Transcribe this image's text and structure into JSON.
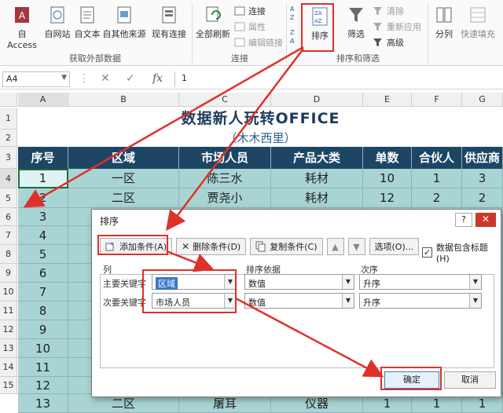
{
  "ribbon": {
    "access": "自 Access",
    "web": "自网站",
    "text": "自文本",
    "other": "自其他来源",
    "existing": "现有连接",
    "refresh_all": "全部刷新",
    "connections": "连接",
    "properties": "属性",
    "edit_links": "编辑链接",
    "sort": "排序",
    "filter": "筛选",
    "clear": "清除",
    "reapply": "重新应用",
    "advanced": "高级",
    "split": "分列",
    "flash_fill": "快速填充",
    "group_external": "获取外部数据",
    "group_connections": "连接",
    "group_sort_filter": "排序和筛选"
  },
  "formula_bar": {
    "name_box": "A4",
    "value": "1"
  },
  "columns": [
    "A",
    "B",
    "C",
    "D",
    "E",
    "F",
    "G"
  ],
  "row_numbers": [
    "1",
    "2",
    "3",
    "4",
    "5",
    "6",
    "7",
    "8",
    "9",
    "10",
    "11",
    "12",
    "13",
    "14",
    "15"
  ],
  "sheet": {
    "title": "数据新人玩转OFFICE",
    "subtitle": "（木木西里）",
    "headers": [
      "序号",
      "区域",
      "市场人员",
      "产品大类",
      "单数",
      "合伙人",
      "供应商"
    ],
    "rows": [
      [
        "1",
        "一区",
        "陈三水",
        "耗材",
        "10",
        "1",
        "3"
      ],
      [
        "2",
        "二区",
        "贾尧小",
        "耗材",
        "12",
        "2",
        "2"
      ]
    ],
    "seq_numbers": [
      "3",
      "4",
      "5",
      "6",
      "7",
      "8",
      "9",
      "10",
      "11",
      "12",
      "13"
    ],
    "last_row": [
      "",
      "二区",
      "屠耳",
      "仪器",
      "1",
      "1",
      "1"
    ]
  },
  "dialog": {
    "title": "排序",
    "help": "?",
    "close": "✕",
    "add": "添加条件(A)",
    "delete": "删除条件(D)",
    "copy": "复制条件(C)",
    "options": "选项(O)...",
    "has_header": "数据包含标题(H)",
    "col_header": "列",
    "basis_header": "排序依据",
    "order_header": "次序",
    "primary_label": "主要关键字",
    "secondary_label": "次要关键字",
    "primary_key": "区域",
    "secondary_key": "市场人员",
    "basis1": "数值",
    "basis2": "数值",
    "order1": "升序",
    "order2": "升序",
    "ok": "确定",
    "cancel": "取消"
  },
  "colors": {
    "header_bg": "#1d4664",
    "teal_fill": "#a9d4d4",
    "red_highlight": "#e0302a"
  }
}
